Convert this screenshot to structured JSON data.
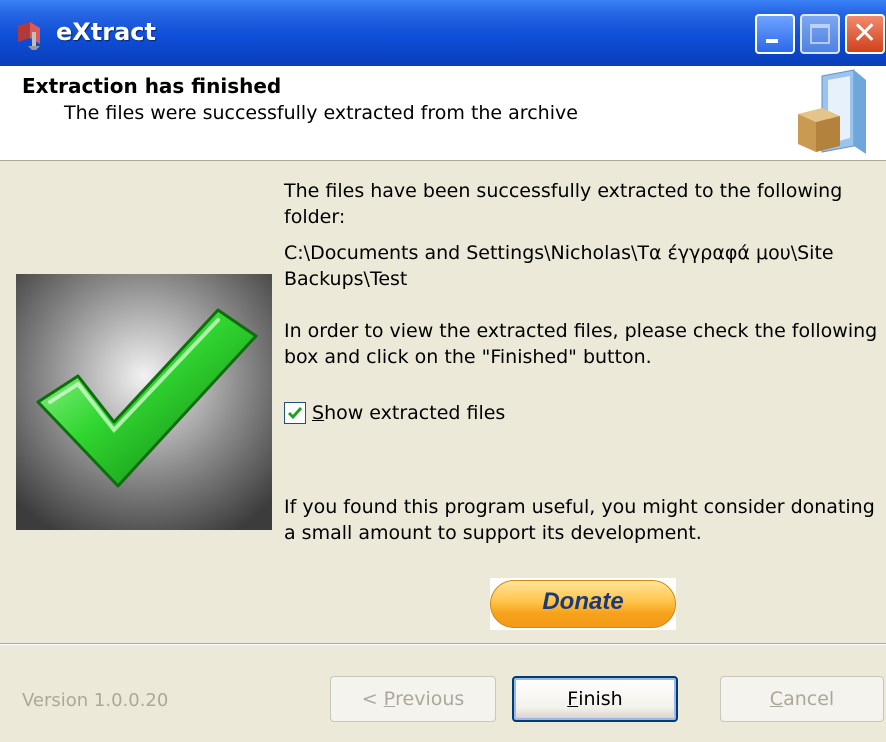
{
  "window": {
    "title": "eXtract",
    "colors": {
      "titlebar": "#0b45c7",
      "background": "#ece9d8",
      "close": "#d1411b"
    }
  },
  "header": {
    "title": "Extraction has finished",
    "subtitle": "The files were successfully extracted from the archive",
    "icon": "folder-package-icon"
  },
  "main": {
    "hero_icon": "green-checkmark-icon",
    "para1_line1": "The files have been successfully extracted to the following",
    "para1_line2": "folder:",
    "path_line1": "C:\\Documents and Settings\\Nicholas\\Τα έγγραφά μου\\Site",
    "path_line2": "Backups\\Test",
    "para2_line1": "In order to view the extracted files, please check the following",
    "para2_line2": "box and click on the \"Finished\" button.",
    "checkbox": {
      "label_first": "S",
      "label_rest": "how extracted files",
      "checked": true
    },
    "para3_line1": "If you found this program useful, you might consider donating",
    "para3_line2": "a small amount to support its development.",
    "donate_label": "Donate"
  },
  "footer": {
    "version": "Version 1.0.0.20",
    "prev": {
      "prefix": "< ",
      "accel": "P",
      "rest": "revious"
    },
    "finish": {
      "accel": "F",
      "rest": "inish"
    },
    "cancel": {
      "accel": "C",
      "rest": "ancel"
    }
  }
}
